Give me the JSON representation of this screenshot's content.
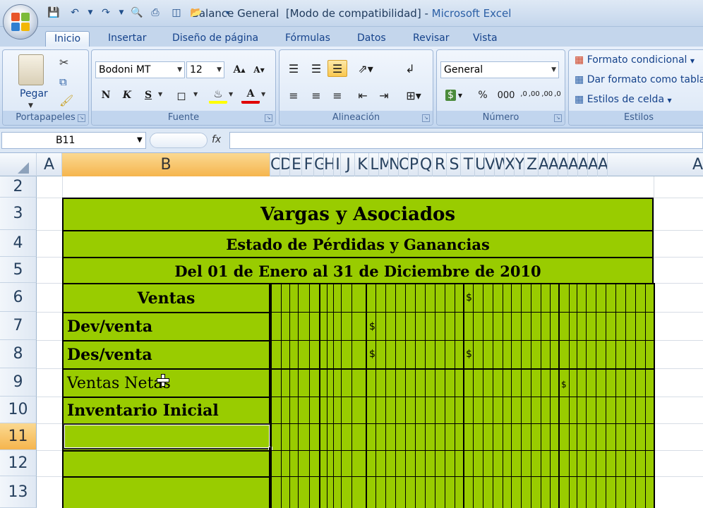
{
  "window": {
    "document_title": "Balance General  [Modo de compatibilidad] - ",
    "app_name": "Microsoft Excel"
  },
  "tabs": [
    "Inicio",
    "Insertar",
    "Diseño de página",
    "Fórmulas",
    "Datos",
    "Revisar",
    "Vista"
  ],
  "ribbon": {
    "clipboard": {
      "paste_label": "Pegar",
      "group_label": "Portapapeles"
    },
    "font": {
      "font_name": "Bodoni MT",
      "font_size": "12",
      "bold": "N",
      "italic": "K",
      "underline": "S",
      "font_color_glyph": "A",
      "grow": "A",
      "shrink": "A",
      "group_label": "Fuente"
    },
    "alignment": {
      "group_label": "Alineación"
    },
    "number": {
      "format": "General",
      "currency": "$",
      "percent": "%",
      "thousands": "000",
      "dec_inc": ",0 ,00",
      "dec_dec": ",00 ,0",
      "group_label": "Número"
    },
    "styles": {
      "conditional": "Formato condicional",
      "as_table": "Dar formato como tabla",
      "cell_styles": "Estilos de celda",
      "group_label": "Estilos"
    }
  },
  "formula_bar": {
    "name_box": "B11",
    "fx": "fx",
    "formula": ""
  },
  "columns": {
    "corner": "",
    "a": "A",
    "b": "B",
    "compressed": [
      "C",
      "D",
      "E",
      "F",
      "G",
      "H",
      "I",
      "J",
      "K",
      "L",
      "M",
      "N",
      "O",
      "P",
      "Q",
      "R",
      "S",
      "T",
      "U",
      "V",
      "W",
      "X",
      "Y",
      "Z",
      "AA",
      "AB",
      "AC",
      "AD",
      "AE",
      "AF",
      "AG"
    ],
    "right_edge": "A"
  },
  "rows": [
    "2",
    "3",
    "4",
    "5",
    "6",
    "7",
    "8",
    "9",
    "10",
    "11",
    "12",
    "13"
  ],
  "selected_row": "11",
  "sheet": {
    "company": "Vargas y Asociados",
    "statement": "Estado de Pérdidas y Ganancias",
    "period": "Del 01 de Enero al 31 de Diciembre de 2010",
    "labels": [
      "Ventas",
      "Dev/venta",
      "Des/venta",
      "Ventas Netas",
      "Inventario Inicial"
    ],
    "dollar_sign": "$"
  },
  "colors": {
    "fill": "#99CC00",
    "selection_header": "#F5B54E",
    "ribbon": "#D1E0F3"
  }
}
